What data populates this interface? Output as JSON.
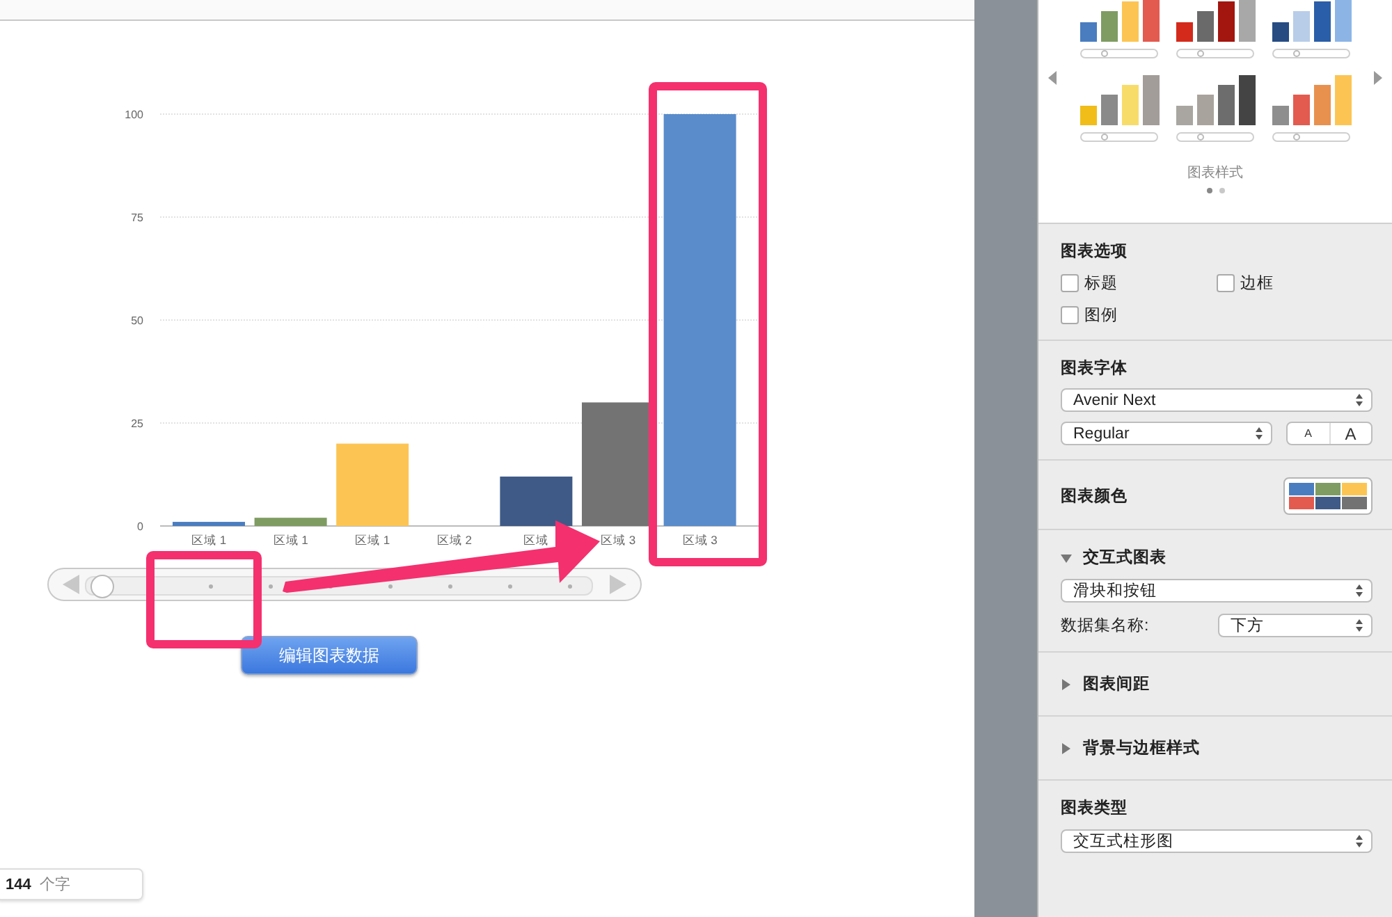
{
  "chart": {
    "chart_data": {
      "type": "bar",
      "categories": [
        "区域 1",
        "区域 1",
        "区域 1",
        "区域 2",
        "区域",
        "区域 3",
        "区域 3"
      ],
      "values": [
        1,
        2,
        20,
        0,
        12,
        30,
        100
      ],
      "colors": [
        "#4a7dbf",
        "#7f9c62",
        "#fcc553",
        null,
        "#3f5a86",
        "#737373",
        "#5a8ccc"
      ],
      "ylim": [
        0,
        100
      ],
      "yticks": [
        0,
        25,
        50,
        75,
        100
      ],
      "grid": true
    },
    "slider": {
      "level": 0
    },
    "edit_button": "编辑图表数据"
  },
  "word_count": {
    "count": "144",
    "unit": "个字"
  },
  "inspector": {
    "styles_label": "图表样式",
    "pages": [
      {
        "selected": true
      },
      {
        "selected": false
      }
    ],
    "options": {
      "title": "图表选项",
      "checkboxes": [
        {
          "label": "标题",
          "checked": false
        },
        {
          "label": "边框",
          "checked": false
        },
        {
          "label": "图例",
          "checked": false
        }
      ]
    },
    "font": {
      "title": "图表字体",
      "family": "Avenir Next",
      "weight": "Regular",
      "smaller": "A",
      "larger": "A"
    },
    "colors": {
      "title": "图表颜色"
    },
    "interactive": {
      "title": "交互式图表",
      "expanded": true,
      "control": "滑块和按钮",
      "dataset_label": "数据集名称:",
      "dataset_value": "下方"
    },
    "collapsed": [
      {
        "title": "图表间距",
        "expanded": false
      },
      {
        "title": "背景与边框样式",
        "expanded": false
      }
    ],
    "chart_type": {
      "title": "图表类型",
      "value": "交互式柱形图"
    }
  }
}
